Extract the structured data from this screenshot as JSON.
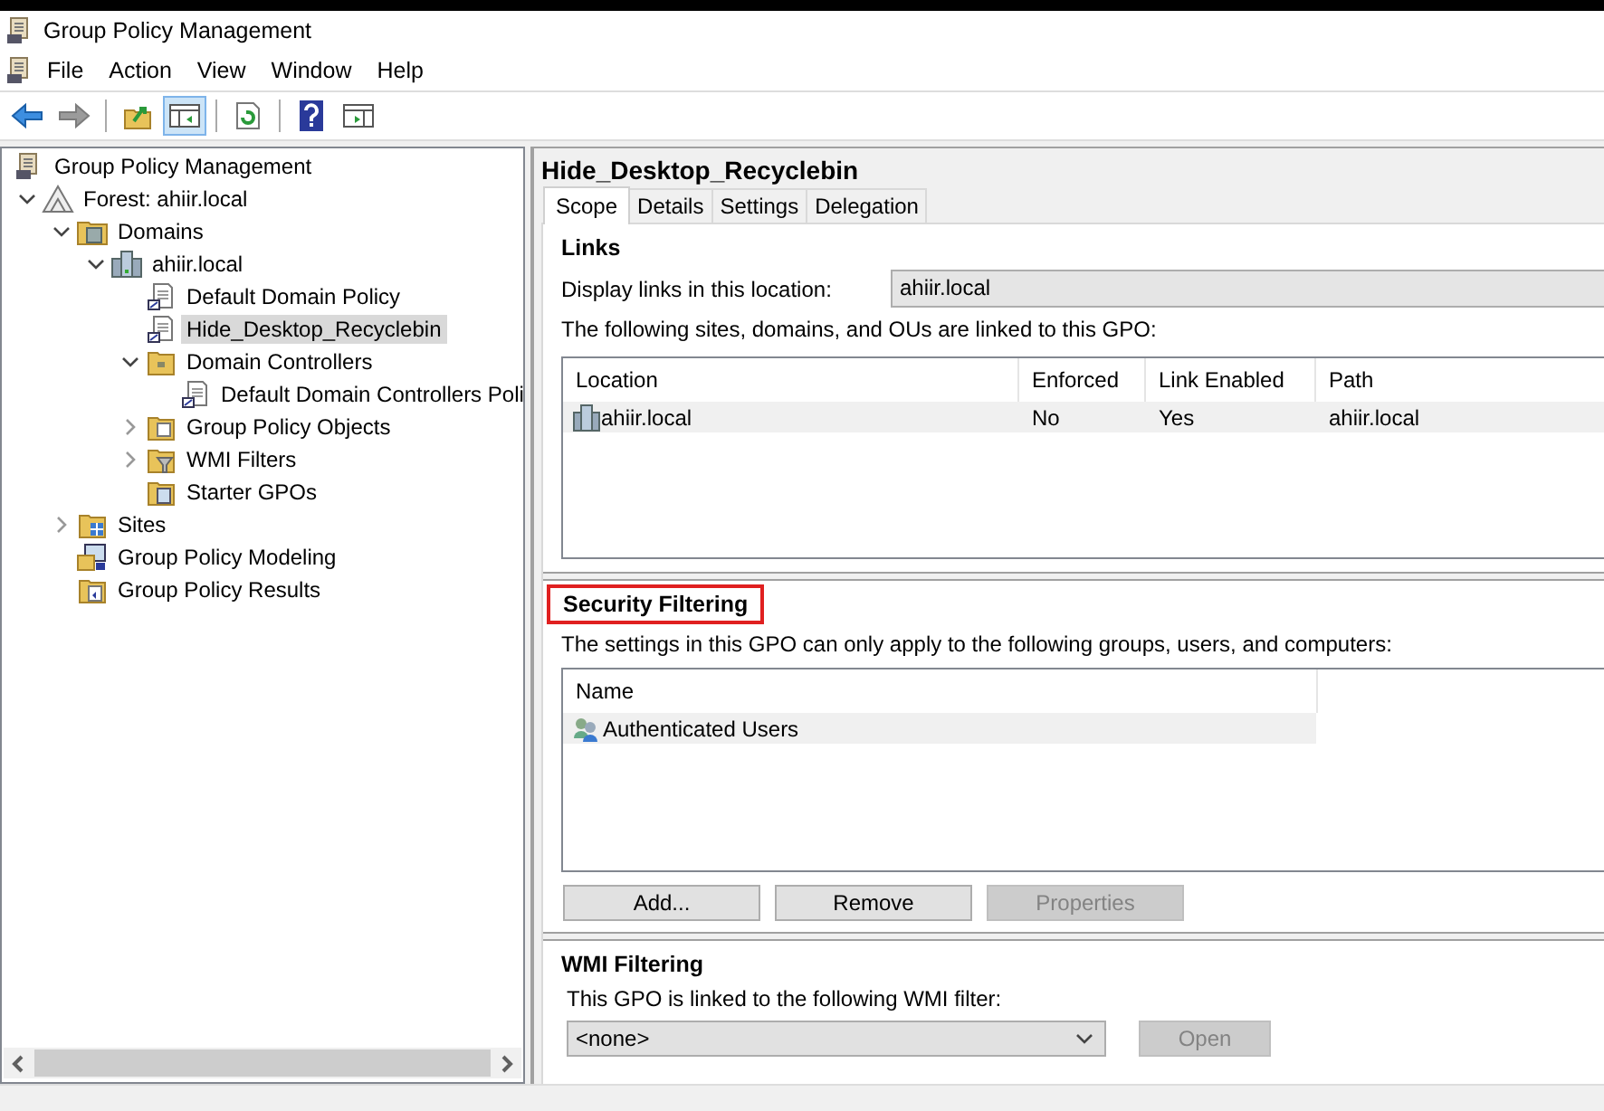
{
  "window": {
    "title": "Group Policy Management"
  },
  "menu": [
    "File",
    "Action",
    "View",
    "Window",
    "Help"
  ],
  "toolbar": [
    [
      {
        "kind": "back",
        "disabled": false,
        "pressed": false
      },
      {
        "kind": "forward",
        "disabled": true,
        "pressed": false
      }
    ],
    [
      {
        "kind": "up-folder",
        "disabled": false,
        "pressed": false
      },
      {
        "kind": "console-tree",
        "disabled": false,
        "pressed": true
      }
    ],
    [
      {
        "kind": "refresh",
        "disabled": false,
        "pressed": false
      }
    ],
    [
      {
        "kind": "help",
        "disabled": false,
        "pressed": false
      },
      {
        "kind": "action-pane",
        "disabled": false,
        "pressed": false
      }
    ]
  ],
  "tree": {
    "label": "Group Policy Management",
    "kind": "root",
    "selected": false,
    "children": [
      {
        "label": "Forest: ahiir.local",
        "kind": "forest",
        "selected": false,
        "expanded": true,
        "children": [
          {
            "label": "Domains",
            "kind": "domains",
            "selected": false,
            "expanded": true,
            "children": [
              {
                "label": "ahiir.local",
                "kind": "domain",
                "selected": false,
                "expanded": true,
                "children": [
                  {
                    "label": "Default Domain Policy",
                    "kind": "gpo-link",
                    "selected": false
                  },
                  {
                    "label": "Hide_Desktop_Recyclebin",
                    "kind": "gpo-link",
                    "selected": true
                  },
                  {
                    "label": "Domain Controllers",
                    "kind": "ou",
                    "selected": false,
                    "expanded": true,
                    "children": [
                      {
                        "label": "Default Domain Controllers Poli",
                        "kind": "gpo-link",
                        "selected": false
                      }
                    ]
                  },
                  {
                    "label": "Group Policy Objects",
                    "kind": "gpo-folder",
                    "selected": false,
                    "expanded": false
                  },
                  {
                    "label": "WMI Filters",
                    "kind": "wmi-folder",
                    "selected": false,
                    "expanded": false
                  },
                  {
                    "label": "Starter GPOs",
                    "kind": "starter-folder",
                    "selected": false
                  }
                ]
              }
            ]
          },
          {
            "label": "Sites",
            "kind": "sites",
            "selected": false,
            "expanded": false
          },
          {
            "label": "Group Policy Modeling",
            "kind": "modeling",
            "selected": false
          },
          {
            "label": "Group Policy Results",
            "kind": "results",
            "selected": false
          }
        ]
      }
    ]
  },
  "details": {
    "title": "Hide_Desktop_Recyclebin",
    "tabs": [
      {
        "label": "Scope",
        "selected": true
      },
      {
        "label": "Details",
        "selected": false
      },
      {
        "label": "Settings",
        "selected": false
      },
      {
        "label": "Delegation",
        "selected": false
      }
    ],
    "links": {
      "heading": "Links",
      "location_label": "Display links in this location:",
      "location_value": "ahiir.local",
      "description": "The following sites, domains, and OUs are linked to this GPO:",
      "columns": [
        "Location",
        "Enforced",
        "Link Enabled",
        "Path"
      ],
      "rows": [
        {
          "cells": [
            "ahiir.local",
            "No",
            "Yes",
            "ahiir.local"
          ],
          "selected": true
        }
      ]
    },
    "security_filtering": {
      "heading": "Security Filtering",
      "highlighted": true,
      "description": "The settings in this GPO can only apply to the following groups, users, and computers:",
      "columns": [
        "Name"
      ],
      "rows": [
        {
          "name": "Authenticated Users",
          "selected": true
        }
      ],
      "buttons": [
        {
          "label": "Add...",
          "disabled": false
        },
        {
          "label": "Remove",
          "disabled": false
        },
        {
          "label": "Properties",
          "disabled": true
        }
      ]
    },
    "wmi_filtering": {
      "heading": "WMI Filtering",
      "description": "This GPO is linked to the following WMI filter:",
      "value": "<none>",
      "button": {
        "label": "Open",
        "disabled": true
      }
    }
  }
}
